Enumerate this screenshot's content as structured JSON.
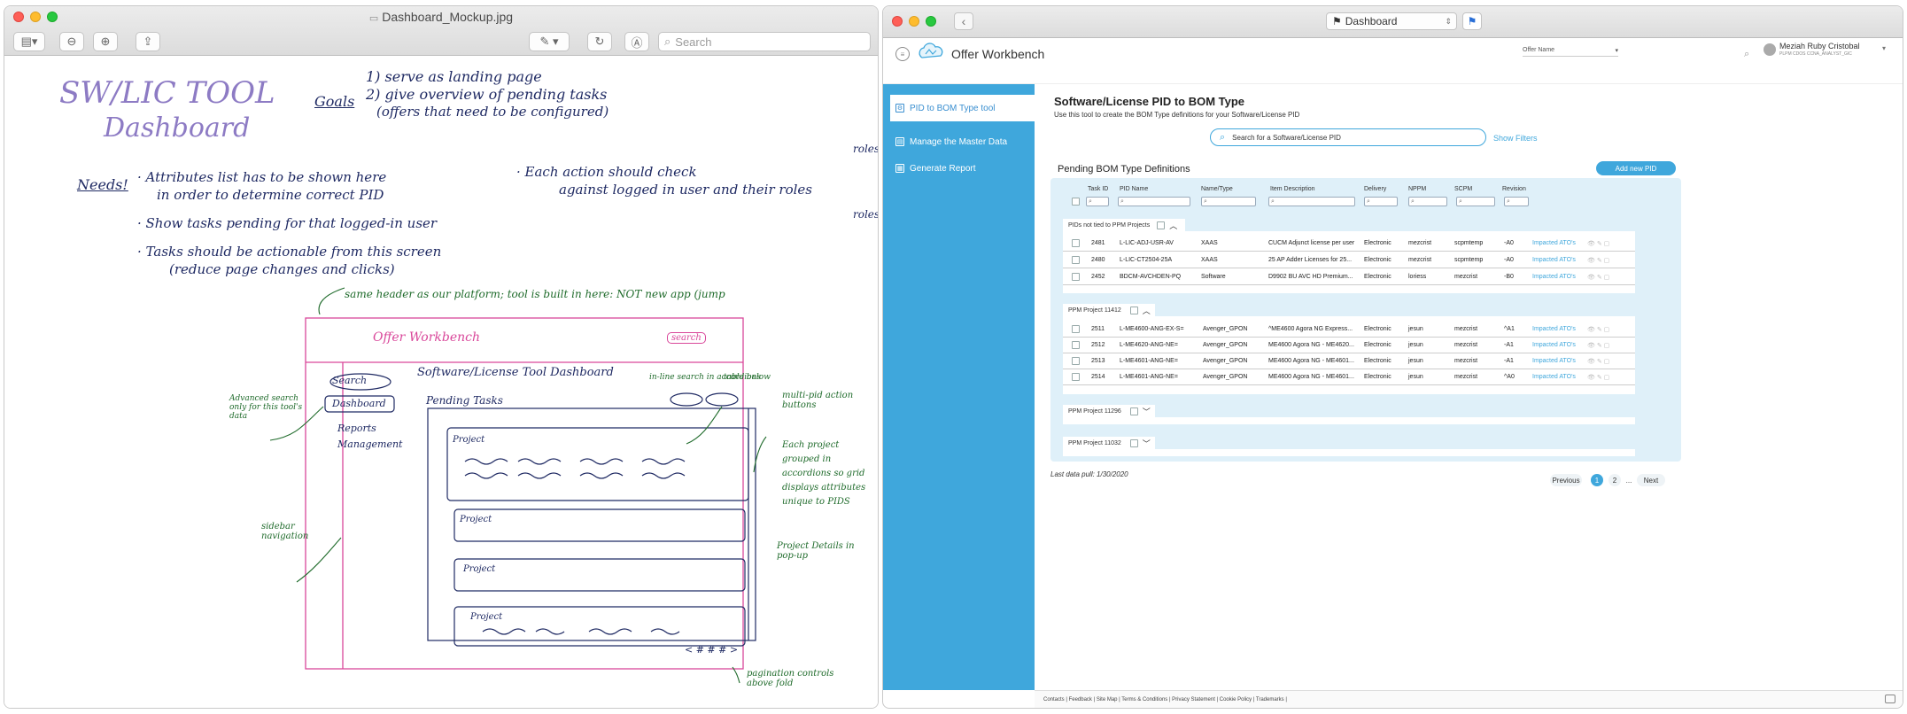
{
  "preview": {
    "title": "Dashboard_Mockup.jpg",
    "search_placeholder": "Search",
    "sketch": {
      "heading1": "SW/LIC TOOL",
      "heading2": "Dashboard",
      "goals_label": "Goals",
      "goal1": "1) serve as landing page",
      "goal2": "2) give overview of pending tasks",
      "goal2b": "(offers that need to be configured)",
      "needs_label": "Needs!",
      "need1a": "· Attributes list has to be shown here",
      "need1b": "in order to determine correct PID",
      "need2": "· Show tasks pending for that logged-in user",
      "need3a": "· Tasks should be actionable from this screen",
      "need3b": "(reduce page changes and clicks)",
      "each_action_a": "· Each action should check",
      "each_action_b": "against logged in user and their roles",
      "roles_right_1": "roles",
      "roles_right_2": "roles",
      "same_header": "same header as our platform; tool is built in here: NOT new app (jump",
      "mock_logo_text": "Offer Workbench",
      "mock_search": "search",
      "mock_page_title": "Software/License Tool Dashboard",
      "mock_pending": "Pending Tasks",
      "mock_search_btn": "Search",
      "mock_dashboard": "Dashboard",
      "mock_reports": "Reports",
      "mock_mgmt": "Management",
      "mock_project": "Project",
      "ann_advanced": "Advanced search only for this tool's data",
      "ann_inline": "in-line search in accordions",
      "ann_table": "table below",
      "ann_multi": "multi-pid action buttons",
      "ann_each_project": "Each project grouped in accordions so grid displays attributes unique to PIDS",
      "ann_details": "Project Details in pop-up",
      "ann_sidebar": "sidebar navigation",
      "ann_pagination": "pagination controls above fold",
      "mock_pager": "< # # # >"
    }
  },
  "browser": {
    "tab_title": "Dashboard",
    "app_title": "Offer Workbench",
    "offer_name_placeholder": "Offer Name",
    "user_name": "Meziah Ruby Cristobal",
    "user_role": "PLPM CDOS CCNA_ANALYST_GIC",
    "sidebar": [
      {
        "label": "PID to BOM Type tool"
      },
      {
        "label": "Manage the Master Data"
      },
      {
        "label": "Generate Report"
      }
    ],
    "page_title": "Software/License PID to BOM Type",
    "page_subtitle": "Use this tool to create the BOM Type definitions for your Software/License PID",
    "search_placeholder": "Search for a Software/License PID",
    "show_filters": "Show Filters",
    "pending_title": "Pending BOM Type Definitions",
    "add_new": "Add new PID",
    "columns": [
      "Task ID",
      "PID Name",
      "Name/Type",
      "Item Description",
      "Delivery",
      "NPPM",
      "SCPM",
      "Revision"
    ],
    "groups": [
      {
        "name": "PIDs not tied to PPM Projects",
        "rows": [
          [
            "2481",
            "L-LIC-ADJ-USR-AV",
            "XAAS",
            "CUCM Adjunct license per user",
            "Electronic",
            "mezcrist",
            "scpmtemp",
            "-A0",
            "Impacted ATO's"
          ],
          [
            "2480",
            "L-LIC-CT2504-25A",
            "XAAS",
            "25 AP Adder Licenses for 25...",
            "Electronic",
            "mezcrist",
            "scpmtemp",
            "-A0",
            "Impacted ATO's"
          ],
          [
            "2452",
            "BDCM-AVCHDEN-PQ",
            "Software",
            "D9902 BU AVC HD Premium...",
            "Electronic",
            "loriess",
            "mezcrist",
            "-B0",
            "Impacted ATO's"
          ]
        ]
      },
      {
        "name": "PPM Project 11412",
        "rows": [
          [
            "2511",
            "L-ME4600-ANG-EX-S=",
            "Avenger_GPON",
            "^ME4600 Agora NG Express...",
            "Electronic",
            "jesun",
            "mezcrist",
            "^A1",
            "Impacted ATO's"
          ],
          [
            "2512",
            "L-ME4620-ANG-NE=",
            "Avenger_GPON",
            "ME4600 Agora NG - ME4620...",
            "Electronic",
            "jesun",
            "mezcrist",
            "-A1",
            "Impacted ATO's"
          ],
          [
            "2513",
            "L-ME4601-ANG-NE=",
            "Avenger_GPON",
            "ME4600 Agora NG - ME4601...",
            "Electronic",
            "jesun",
            "mezcrist",
            "-A1",
            "Impacted ATO's"
          ],
          [
            "2514",
            "L-ME4601-ANG-NE=",
            "Avenger_GPON",
            "ME4600 Agora NG - ME4601...",
            "Electronic",
            "jesun",
            "mezcrist",
            "^A0",
            "Impacted ATO's"
          ]
        ]
      },
      {
        "name": "PPM Project 11296",
        "rows": []
      },
      {
        "name": "PPM Project 11032",
        "rows": []
      }
    ],
    "last_pull": "Last data pull: 1/30/2020",
    "pager": {
      "prev": "Previous",
      "p1": "1",
      "p2": "2",
      "dots": "...",
      "next": "Next"
    },
    "footer": "Contacts | Feedback | Site Map | Terms & Conditions | Privacy Statement | Cookie Policy | Trademarks |",
    "accent_color": "#3fa7dc"
  }
}
